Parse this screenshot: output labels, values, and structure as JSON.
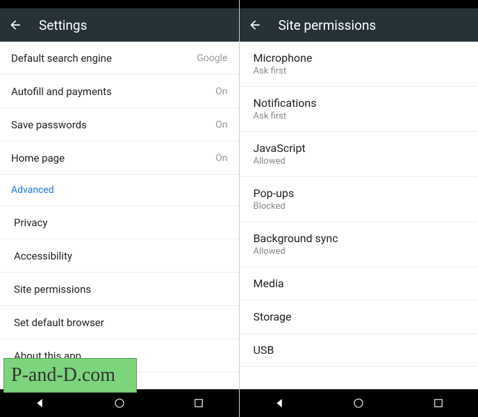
{
  "left": {
    "title": "Settings",
    "rows": [
      {
        "label": "Default search engine",
        "value": "Google"
      },
      {
        "label": "Autofill and payments",
        "value": "On"
      },
      {
        "label": "Save passwords",
        "value": "On"
      },
      {
        "label": "Home page",
        "value": "On"
      }
    ],
    "section": "Advanced",
    "advanced_rows": [
      {
        "label": "Privacy"
      },
      {
        "label": "Accessibility"
      },
      {
        "label": "Site permissions"
      },
      {
        "label": "Set default browser"
      },
      {
        "label": "About this app"
      }
    ]
  },
  "right": {
    "title": "Site permissions",
    "rows": [
      {
        "label": "Microphone",
        "sub": "Ask first"
      },
      {
        "label": "Notifications",
        "sub": "Ask first"
      },
      {
        "label": "JavaScript",
        "sub": "Allowed"
      },
      {
        "label": "Pop-ups",
        "sub": "Blocked"
      },
      {
        "label": "Background sync",
        "sub": "Allowed"
      },
      {
        "label": "Media",
        "sub": ""
      },
      {
        "label": "Storage",
        "sub": ""
      },
      {
        "label": "USB",
        "sub": ""
      }
    ]
  },
  "watermark": "P-and-D.com"
}
